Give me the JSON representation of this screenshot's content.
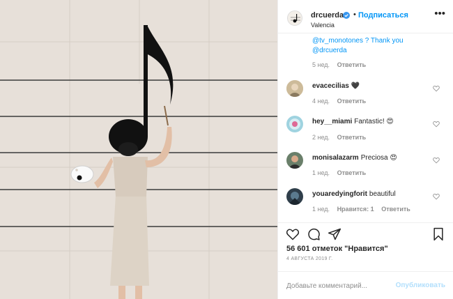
{
  "photo": {
    "alt_description": ""
  },
  "header": {
    "username": "drcuerda",
    "follow_label": "Подписаться",
    "separator": "•",
    "location": "Valencia",
    "more_label": "•••"
  },
  "caption_tail": {
    "line1": "@tv_monotones ? Thank you",
    "line2": "@drcuerda",
    "time": "5 нед.",
    "reply_label": "Ответить"
  },
  "comments": [
    {
      "username": "evacecilias",
      "text": "🖤",
      "time": "4 нед.",
      "likes": "",
      "reply_label": "Ответить"
    },
    {
      "username": "hey__miami",
      "text": "Fantastic! 😍",
      "time": "2 нед.",
      "likes": "",
      "reply_label": "Ответить"
    },
    {
      "username": "monisalazarm",
      "text": "Preciosa 😍",
      "time": "1 нед.",
      "likes": "",
      "reply_label": "Ответить"
    },
    {
      "username": "youaredyingforit",
      "text": "beautiful",
      "time": "1 нед.",
      "likes": "Нравится: 1",
      "reply_label": "Ответить"
    }
  ],
  "footer": {
    "likes_text": "56 601 отметок \"Нравится\"",
    "date_text": "4 АВГУСТА 2019 Г.",
    "comment_placeholder": "Добавьте комментарий...",
    "post_label": "Опубликовать"
  },
  "colors": {
    "accent": "#0095f6",
    "post_disabled": "#b2dffc",
    "muted": "#8e8e8e",
    "wall": "#e6dfd8"
  }
}
